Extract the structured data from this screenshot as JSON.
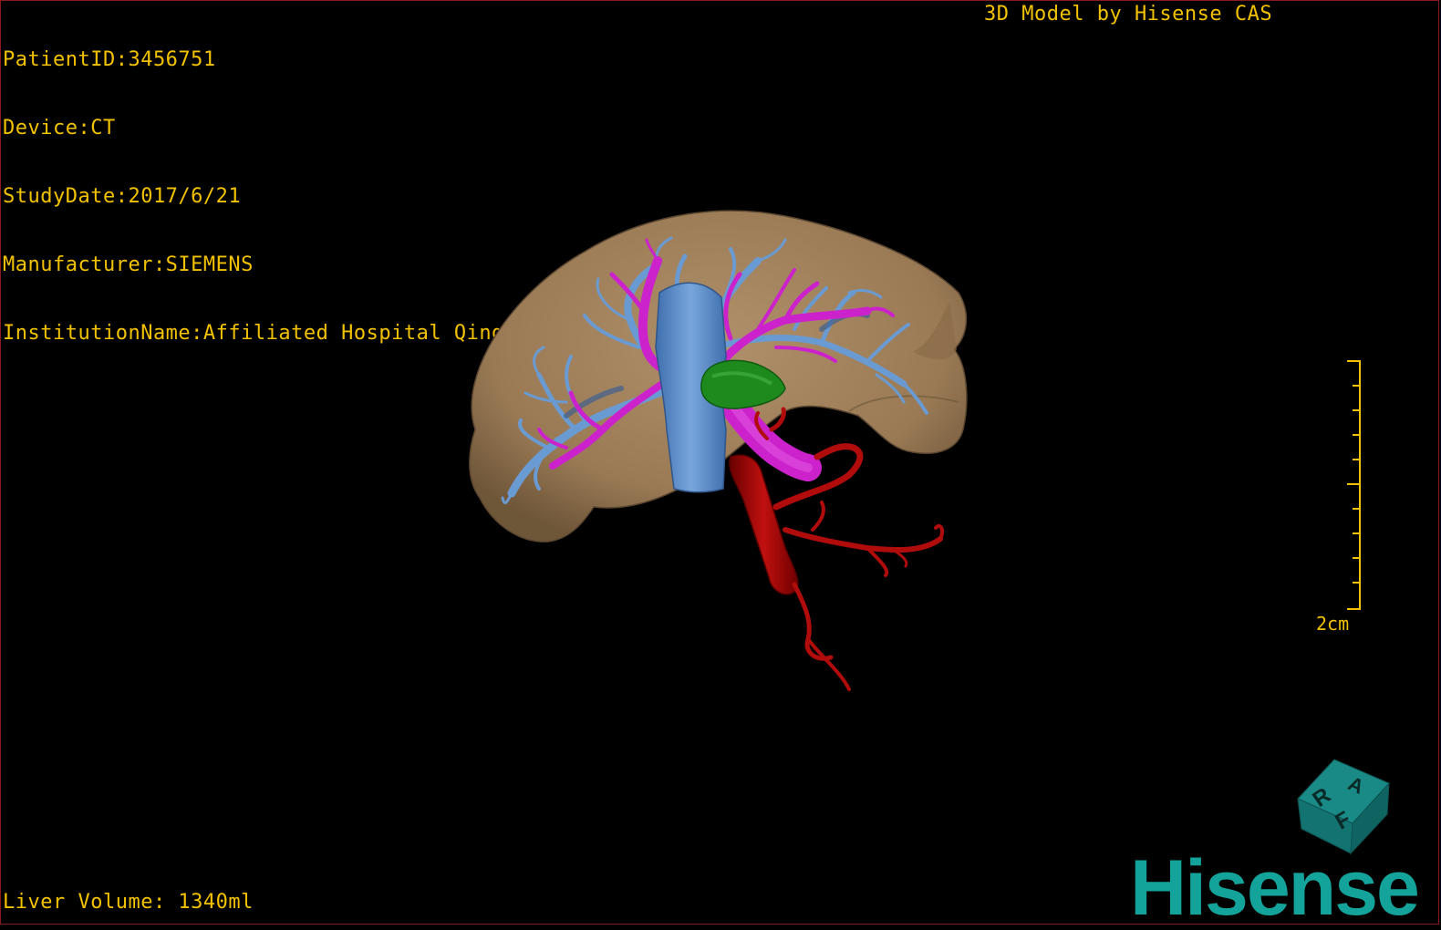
{
  "patient_info": {
    "patient_id": "PatientID:3456751",
    "device": "Device:CT",
    "study_date": "StudyDate:2017/6/21",
    "manufacturer": "Manufacturer:SIEMENS",
    "institution": "InstitutionName:Affiliated Hospital Qingdao University-C"
  },
  "credit": "3D Model by Hisense CAS",
  "liver_volume": "Liver Volume: 1340ml",
  "scale": {
    "label": "2cm"
  },
  "orientation_cube": {
    "labels": [
      "R",
      "A",
      "F"
    ]
  },
  "logo": "Hisense",
  "colors": {
    "overlay_text": "#f2c200",
    "liver": "#9a7a55",
    "portal_vein": "#6a9ad2",
    "hepatic_vein": "#cc22cc",
    "artery": "#b00c0c",
    "gallbladder": "#1e8a1e",
    "brand": "#14a39a"
  }
}
